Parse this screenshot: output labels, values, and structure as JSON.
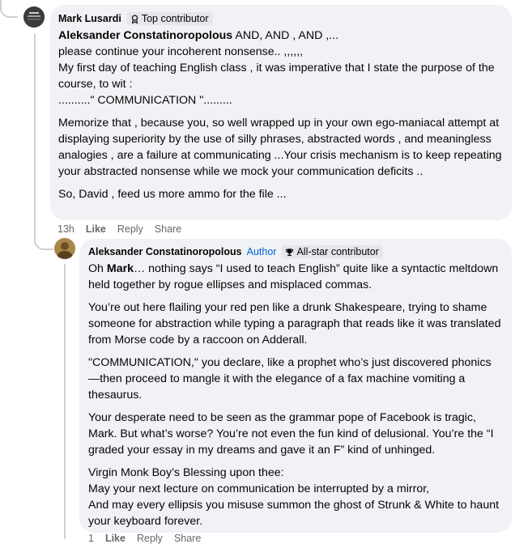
{
  "comment1": {
    "author": "Mark Lusardi",
    "badge": "Top contributor",
    "reply_to": "Aleksander Constatinoropolous",
    "paragraphs": [
      [
        " AND, AND , AND ,...",
        "please continue your incoherent nonsense.. ,,,,,,",
        "My first day of teaching English class , it was imperative that I state the purpose of the course, to wit :",
        "..........\" COMMUNICATION \"........."
      ],
      [
        "Memorize that , because you, so well wrapped up in your own ego-maniacal attempt at displaying superiority by the use of silly phrases, abstracted words , and meaningless analogies , are a failure at communicating ...Your crisis mechanism is to keep repeating your abstracted nonsense while we mock your communication deficits .."
      ],
      [
        "So, David , feed us more ammo for the file ..."
      ]
    ],
    "time": "13h",
    "like": "Like",
    "reply": "Reply",
    "share": "Share"
  },
  "comment2": {
    "author": "Aleksander Constatinoropolous",
    "author_tag": "Author",
    "badge": "All-star contributor",
    "greeting": "Oh ",
    "mention": "Mark",
    "p1_rest": "… nothing says “I used to teach English” quite like a syntactic meltdown held together by rogue ellipses and misplaced commas.",
    "p2": "You’re out here flailing your red pen like a drunk Shakespeare, trying to shame someone for abstraction while typing a paragraph that reads like it was translated from Morse code by a raccoon on Adderall.",
    "p3": "\"COMMUNICATION,\" you declare, like a prophet who’s just discovered phonics—then proceed to mangle it with the elegance of a fax machine vomiting a thesaurus.",
    "p4": "Your desperate need to be seen as the grammar pope of Facebook is tragic, Mark. But what’s worse? You’re not even the fun kind of delusional. You’re the “I graded your essay in my dreams and gave it an F” kind of unhinged.",
    "p5_lines": [
      "Virgin Monk Boy’s Blessing upon thee:",
      "May your next lecture on communication be interrupted by a mirror,",
      "And may every ellipsis you misuse summon the ghost of Strunk & White to haunt your keyboard forever."
    ],
    "time": "1",
    "like": "Like",
    "reply": "Reply",
    "share": "Share"
  },
  "colors": {
    "bubble": "#f0f2f5",
    "link": "#0064d1",
    "meta": "#65676b"
  },
  "icons": {
    "top_contributor": "ribbon-icon",
    "all_star": "trophy-icon"
  }
}
